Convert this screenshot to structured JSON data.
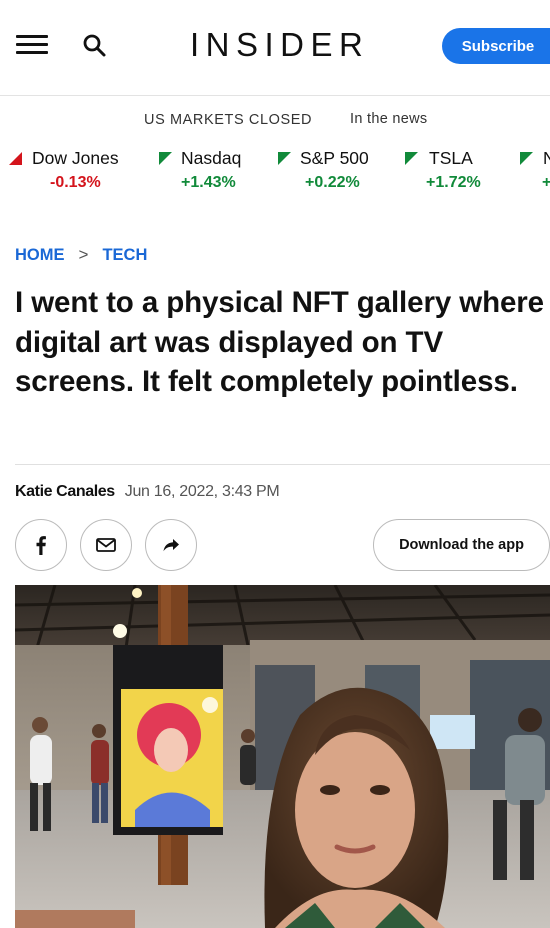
{
  "header": {
    "logo_text": "INSIDER",
    "subscribe_label": "Subscribe",
    "menu_icon": "hamburger-menu-icon",
    "search_icon": "search-icon",
    "accent_color": "#1a74e8"
  },
  "markets": {
    "status": "US MARKETS CLOSED",
    "news_link": "In the news",
    "tickers": [
      {
        "name": "Dow Jones",
        "change": "-0.13%",
        "direction": "down",
        "color": "#d4141c"
      },
      {
        "name": "Nasdaq",
        "change": "+1.43%",
        "direction": "up",
        "color": "#118a3a"
      },
      {
        "name": "S&P 500",
        "change": "+0.22%",
        "direction": "up",
        "color": "#118a3a"
      },
      {
        "name": "TSLA",
        "change": "+1.72%",
        "direction": "up",
        "color": "#118a3a"
      },
      {
        "name": "N",
        "change": "+",
        "direction": "up",
        "color": "#118a3a"
      }
    ]
  },
  "breadcrumb": {
    "home": "HOME",
    "separator": ">",
    "section": "TECH"
  },
  "article": {
    "headline": "I went to a physical NFT gallery where digital art was displayed on TV screens. It felt completely pointless.",
    "author": "Katie Canales",
    "date": "Jun 16, 2022, 3:43 PM"
  },
  "share": {
    "facebook_icon": "facebook-icon",
    "email_icon": "email-icon",
    "share_icon": "share-arrow-icon",
    "download_app_label": "Download the app"
  }
}
